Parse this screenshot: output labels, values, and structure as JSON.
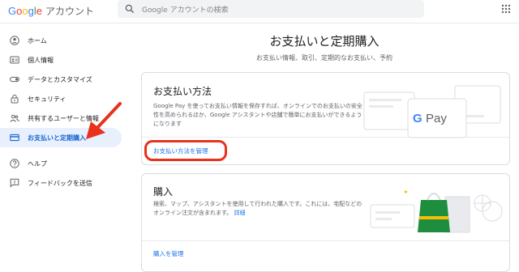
{
  "header": {
    "logo_letters": [
      "G",
      "o",
      "o",
      "g",
      "l",
      "e"
    ],
    "account_label": "アカウント",
    "search_placeholder": "Google アカウントの検索"
  },
  "sidebar": {
    "items": [
      {
        "label": "ホーム",
        "icon": "person-circle-icon",
        "active": false
      },
      {
        "label": "個人情報",
        "icon": "id-card-icon",
        "active": false
      },
      {
        "label": "データとカスタマイズ",
        "icon": "toggle-icon",
        "active": false
      },
      {
        "label": "セキュリティ",
        "icon": "lock-icon",
        "active": false
      },
      {
        "label": "共有するユーザーと情報",
        "icon": "people-icon",
        "active": false
      },
      {
        "label": "お支払いと定期購入",
        "icon": "credit-card-icon",
        "active": true
      },
      {
        "label": "ヘルプ",
        "icon": "help-circle-icon",
        "active": false
      },
      {
        "label": "フィードバックを送信",
        "icon": "feedback-icon",
        "active": false
      }
    ]
  },
  "main": {
    "title": "お支払いと定期購入",
    "subtitle": "お支払い情報、取引、定期的なお支払い、予約",
    "payment_card": {
      "title": "お支払い方法",
      "description": "Google Pay を使ってお支払い情報を保存すれば、オンラインでのお支払いの安全性を高められるほか、Google アシスタントや店舗で簡単にお支払いができるようになります",
      "link": "お支払い方法を管理",
      "gpay_label": "Pay"
    },
    "purchases_card": {
      "title": "購入",
      "description": "検索、マップ、アシスタントを使用して行われた購入です。これには、宅配などのオンライン注文が含まれます。",
      "detail_link": "詳細",
      "link": "購入を管理"
    }
  },
  "colors": {
    "accent": "#1a73e8",
    "active_bg": "#e8f0fe",
    "annotation_red": "#e8321c",
    "bag_green": "#1e8e3e",
    "bag_yellow": "#fbbc04"
  }
}
